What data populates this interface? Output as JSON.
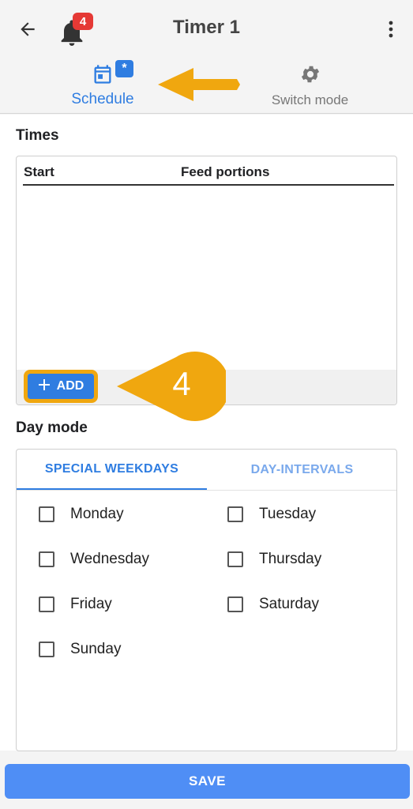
{
  "appbar": {
    "title": "Timer 1",
    "notification_count": "4",
    "icons": [
      "back-arrow-icon",
      "bell-icon",
      "more-vert-icon"
    ]
  },
  "mode_tabs": {
    "schedule": {
      "label": "Schedule",
      "badge": "*",
      "icon": "calendar-icon"
    },
    "switch_mode": {
      "label": "Switch mode",
      "icon": "gear-icon"
    }
  },
  "times": {
    "title": "Times",
    "columns": [
      "Start",
      "Feed portions"
    ],
    "rows": [],
    "add_label": "ADD"
  },
  "day_mode": {
    "title": "Day mode",
    "tabs": [
      "SPECIAL WEEKDAYS",
      "DAY-INTERVALS"
    ],
    "active_tab": "SPECIAL WEEKDAYS",
    "days": [
      "Monday",
      "Tuesday",
      "Wednesday",
      "Thursday",
      "Friday",
      "Saturday",
      "Sunday"
    ]
  },
  "save_label": "SAVE",
  "annotation": {
    "step_number": "4"
  },
  "colors": {
    "accent": "#2f7de1",
    "highlight": "#f0a70f",
    "badge": "#e53935"
  }
}
